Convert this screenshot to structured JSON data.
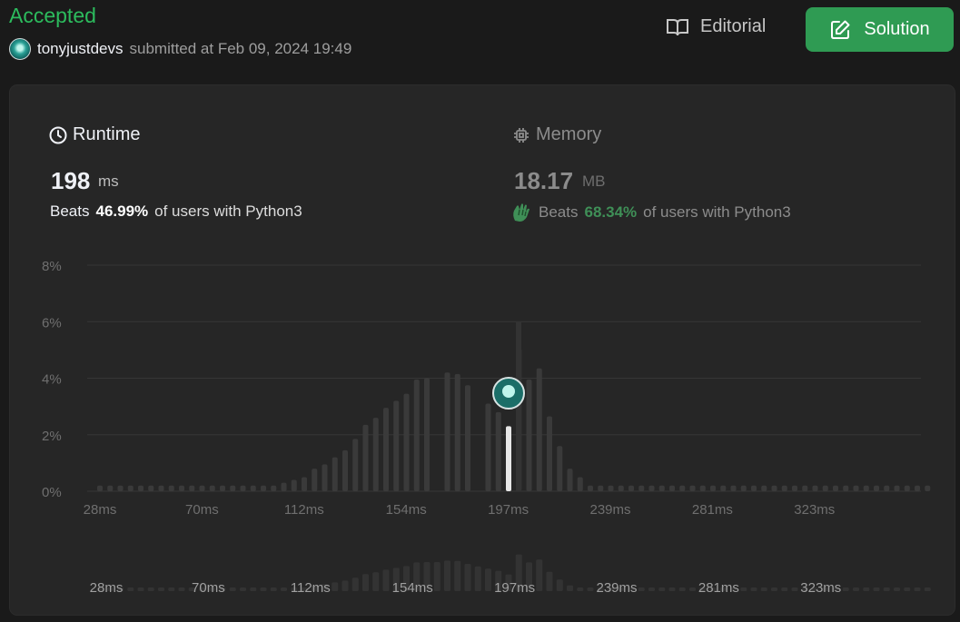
{
  "header": {
    "status": "Accepted",
    "username": "tonyjustdevs",
    "submitted_text": "submitted at Feb 09, 2024 19:49",
    "editorial_label": "Editorial",
    "solution_label": "Solution"
  },
  "runtime": {
    "title": "Runtime",
    "value": "198",
    "unit": "ms",
    "beats_label": "Beats",
    "beats_pct": "46.99%",
    "beats_rest": "of users with Python3"
  },
  "memory": {
    "title": "Memory",
    "value": "18.17",
    "unit": "MB",
    "beats_label": "Beats",
    "beats_pct": "68.34%",
    "beats_rest": "of users with Python3"
  },
  "colors": {
    "accepted": "#2cbb5d",
    "solution_button": "#2f9b53",
    "bar": "#3a3a3a",
    "highlight_bar": "#e6e6e6",
    "memory_beats_pct": "#3f8f57"
  },
  "chart_data": {
    "type": "bar",
    "y_ticks": [
      "8%",
      "6%",
      "4%",
      "2%",
      "0%"
    ],
    "ylim": [
      0,
      8
    ],
    "x_tick_labels": [
      "28ms",
      "70ms",
      "112ms",
      "154ms",
      "197ms",
      "239ms",
      "281ms",
      "323ms"
    ],
    "values": [
      0.2,
      0.2,
      0.2,
      0.2,
      0.2,
      0.2,
      0.2,
      0.2,
      0.2,
      0.2,
      0.2,
      0.2,
      0.2,
      0.2,
      0.2,
      0.2,
      0.2,
      0.2,
      0.3,
      0.4,
      0.5,
      0.8,
      0.95,
      1.2,
      1.45,
      1.85,
      2.35,
      2.6,
      2.95,
      3.2,
      3.45,
      3.95,
      4.0,
      0.0,
      4.2,
      4.15,
      3.75,
      0.0,
      3.1,
      2.8,
      2.3,
      5.05,
      3.95,
      4.35,
      2.65,
      1.6,
      0.8,
      0.5,
      0.2,
      0.2,
      0.2,
      0.2,
      0.2,
      0.2,
      0.2,
      0.2,
      0.2,
      0.2,
      0.2,
      0.2,
      0.2,
      0.2,
      0.2,
      0.2,
      0.2,
      0.2,
      0.2,
      0.2,
      0.2,
      0.2,
      0.2,
      0.2,
      0.2,
      0.2,
      0.2,
      0.2,
      0.2,
      0.2,
      0.2,
      0.2,
      0.2,
      0.2
    ],
    "highlight_index": 40,
    "highlight_x_label": "197ms",
    "highlight_value": 2.3,
    "overview_values": [
      0.2,
      0.2,
      0.2,
      0.2,
      0.2,
      0.2,
      0.2,
      0.2,
      0.2,
      0.2,
      0.2,
      0.2,
      0.2,
      0.2,
      0.2,
      0.2,
      0.2,
      0.2,
      0.3,
      0.4,
      0.5,
      0.8,
      0.95,
      1.2,
      1.45,
      1.85,
      2.35,
      2.6,
      2.95,
      3.2,
      3.45,
      3.95,
      4.0,
      4.0,
      4.2,
      4.15,
      3.75,
      3.4,
      3.1,
      2.8,
      2.3,
      5.05,
      3.95,
      4.35,
      2.65,
      1.6,
      0.8,
      0.5,
      0.2,
      0.2,
      0.2,
      0.2,
      0.2,
      0.2,
      0.2,
      0.2,
      0.2,
      0.2,
      0.2,
      0.2,
      0.2,
      0.2,
      0.2,
      0.2,
      0.2,
      0.2,
      0.2,
      0.2,
      0.2,
      0.2,
      0.2,
      0.2,
      0.2,
      0.2,
      0.2,
      0.2,
      0.2,
      0.2,
      0.2,
      0.2,
      0.2,
      0.2
    ],
    "grid": true
  }
}
